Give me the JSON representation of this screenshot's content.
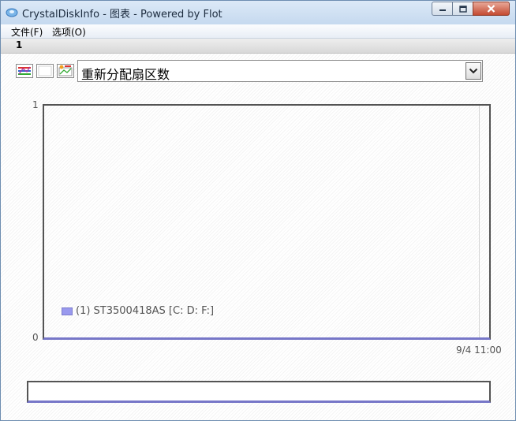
{
  "window": {
    "title": "CrystalDiskInfo - 图表 - Powered by Flot",
    "icon": "crystaldiskinfo-icon",
    "buttons": {
      "minimize": "minimize-icon",
      "maximize": "maximize-icon",
      "close": "close-icon"
    }
  },
  "menu": {
    "items": [
      "文件(F)",
      "选项(O)"
    ]
  },
  "tabs": [
    {
      "label": "1"
    }
  ],
  "toolbar": {
    "buttons": [
      "chart-multi-icon",
      "blank-square-icon",
      "chart-edit-icon"
    ],
    "attribute_select": {
      "value": "重新分配扇区数"
    }
  },
  "colors": {
    "series": "#9999ee",
    "axis": "#545454",
    "close_button": "#c44a31"
  },
  "chart_data": {
    "type": "line",
    "series": [
      {
        "name": "(1) ST3500418AS [C: D: F:]",
        "values": [
          0
        ]
      }
    ],
    "x": [
      "9/4 11:00"
    ],
    "ylim": [
      0,
      1
    ],
    "yticks": [
      "1",
      "0"
    ],
    "xticks": [
      "9/4 11:00"
    ],
    "legend_position": "bottom-left",
    "grid": false
  }
}
